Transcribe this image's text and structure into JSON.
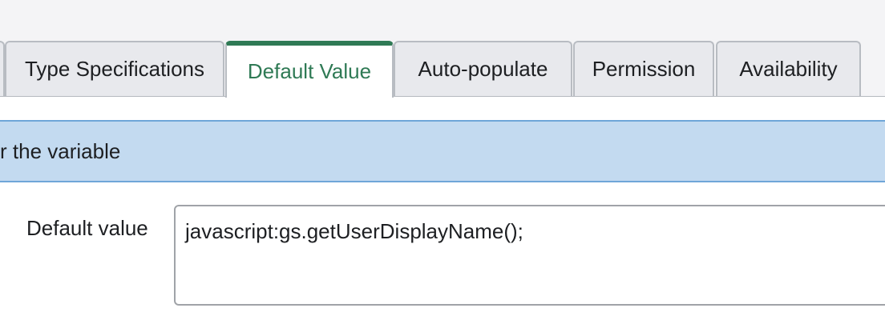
{
  "tabs": [
    {
      "label": "",
      "active": false
    },
    {
      "label": "Type Specifications",
      "active": false
    },
    {
      "label": "Default Value",
      "active": true
    },
    {
      "label": "Auto-populate",
      "active": false
    },
    {
      "label": "Permission",
      "active": false
    },
    {
      "label": "Availability",
      "active": false
    }
  ],
  "section": {
    "banner_text": "r the variable"
  },
  "form": {
    "default_value_label": "Default value",
    "default_value": "javascript:gs.getUserDisplayName();"
  },
  "colors": {
    "active_tab": "#2f7a55",
    "banner_bg": "#c3daf0",
    "banner_border": "#6fa6d8"
  }
}
